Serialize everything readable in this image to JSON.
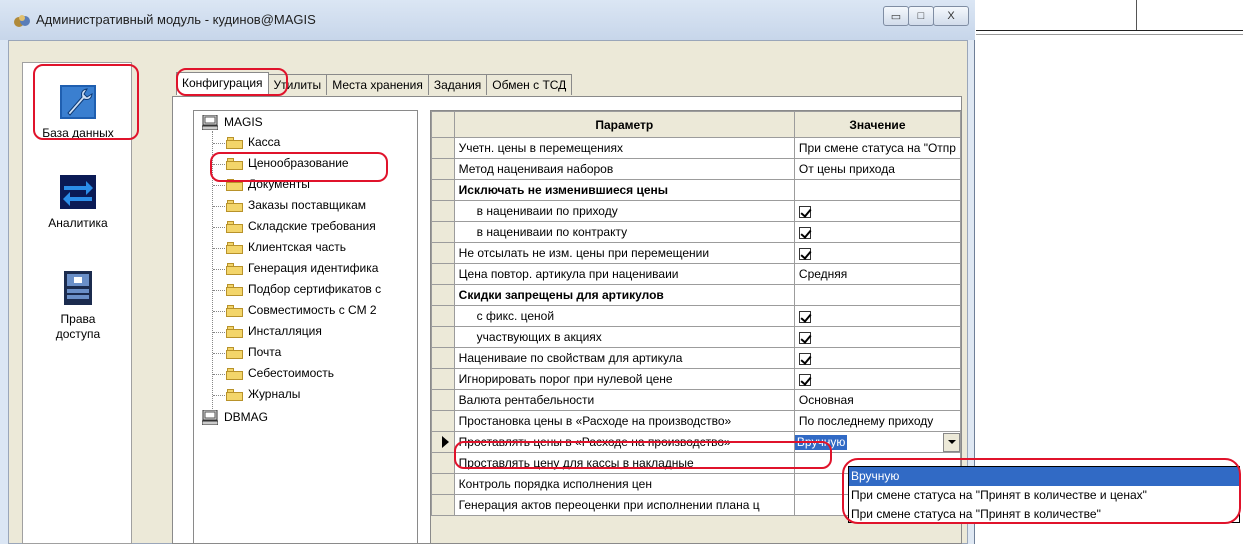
{
  "window": {
    "title": "Административный модуль - кудинов@MAGIS",
    "min_glyph": "▭",
    "max_glyph": "□",
    "close_glyph": "X"
  },
  "leftbar": {
    "items": [
      {
        "label": "База данных",
        "icon": "database-wrench-icon"
      },
      {
        "label": "Аналитика",
        "icon": "arrows-exchange-icon"
      },
      {
        "label": "Права доступа",
        "icon": "access-rights-icon"
      }
    ]
  },
  "tabs": [
    "Конфигурация",
    "Утилиты",
    "Места хранения",
    "Задания",
    "Обмен с ТСД"
  ],
  "tree": {
    "root": "MAGIS",
    "children": [
      "Касса",
      "Ценообразование",
      "Документы",
      "Заказы поставщикам",
      "Складские требования",
      "Клиентская часть",
      "Генерация идентифика",
      "Подбор сертификатов с",
      "Совместимость с СМ 2",
      "Инсталляция",
      "Почта",
      "Себестоимость",
      "Журналы"
    ],
    "root2": "DBMAG"
  },
  "grid": {
    "headers": {
      "param": "Параметр",
      "value": "Значение"
    },
    "rows": [
      {
        "param": "Учетн. цены в перемещениях",
        "value": "При смене статуса на \"Отпр"
      },
      {
        "param": "Метод нацениваия наборов",
        "value": "От цены прихода"
      },
      {
        "param": "Исключать не изменившиеся цены",
        "value": ""
      },
      {
        "param": "в нацениваии по приходу",
        "value": ""
      },
      {
        "param": "в нацениваии по контракту",
        "value": ""
      },
      {
        "param": "Не отсылать не изм. цены при перемещении",
        "value": ""
      },
      {
        "param": "Цена повтор. артикула при нацениваии",
        "value": "Средняя"
      },
      {
        "param": "Скидки запрещены для артикулов",
        "value": ""
      },
      {
        "param": "с фикс. ценой",
        "value": ""
      },
      {
        "param": "участвующих в акциях",
        "value": ""
      },
      {
        "param": "Нацениваие по свойствам для артикула",
        "value": ""
      },
      {
        "param": "Игнорировать порог при нулевой цене",
        "value": ""
      },
      {
        "param": "Валюта рентабельности",
        "value": "Основная"
      },
      {
        "param": "Простановка цены в «Расходе на производство»",
        "value": "По последнему приходу"
      },
      {
        "param": "Проставлять цены в «Расходе на производство»",
        "value": "Вручную"
      },
      {
        "param": "Проставлять цену для кассы в накладные",
        "value": ""
      },
      {
        "param": "Контроль порядка исполнения цен",
        "value": ""
      },
      {
        "param": "Генерация актов переоценки при исполнении плана ц",
        "value": ""
      }
    ]
  },
  "dropdown": {
    "options": [
      "Вручную",
      "При смене статуса на \"Принят в количестве и ценах\"",
      "При смене статуса на \"Принят в количестве\""
    ]
  },
  "colors": {
    "highlight": "#e0132b",
    "selection": "#316ac5"
  }
}
